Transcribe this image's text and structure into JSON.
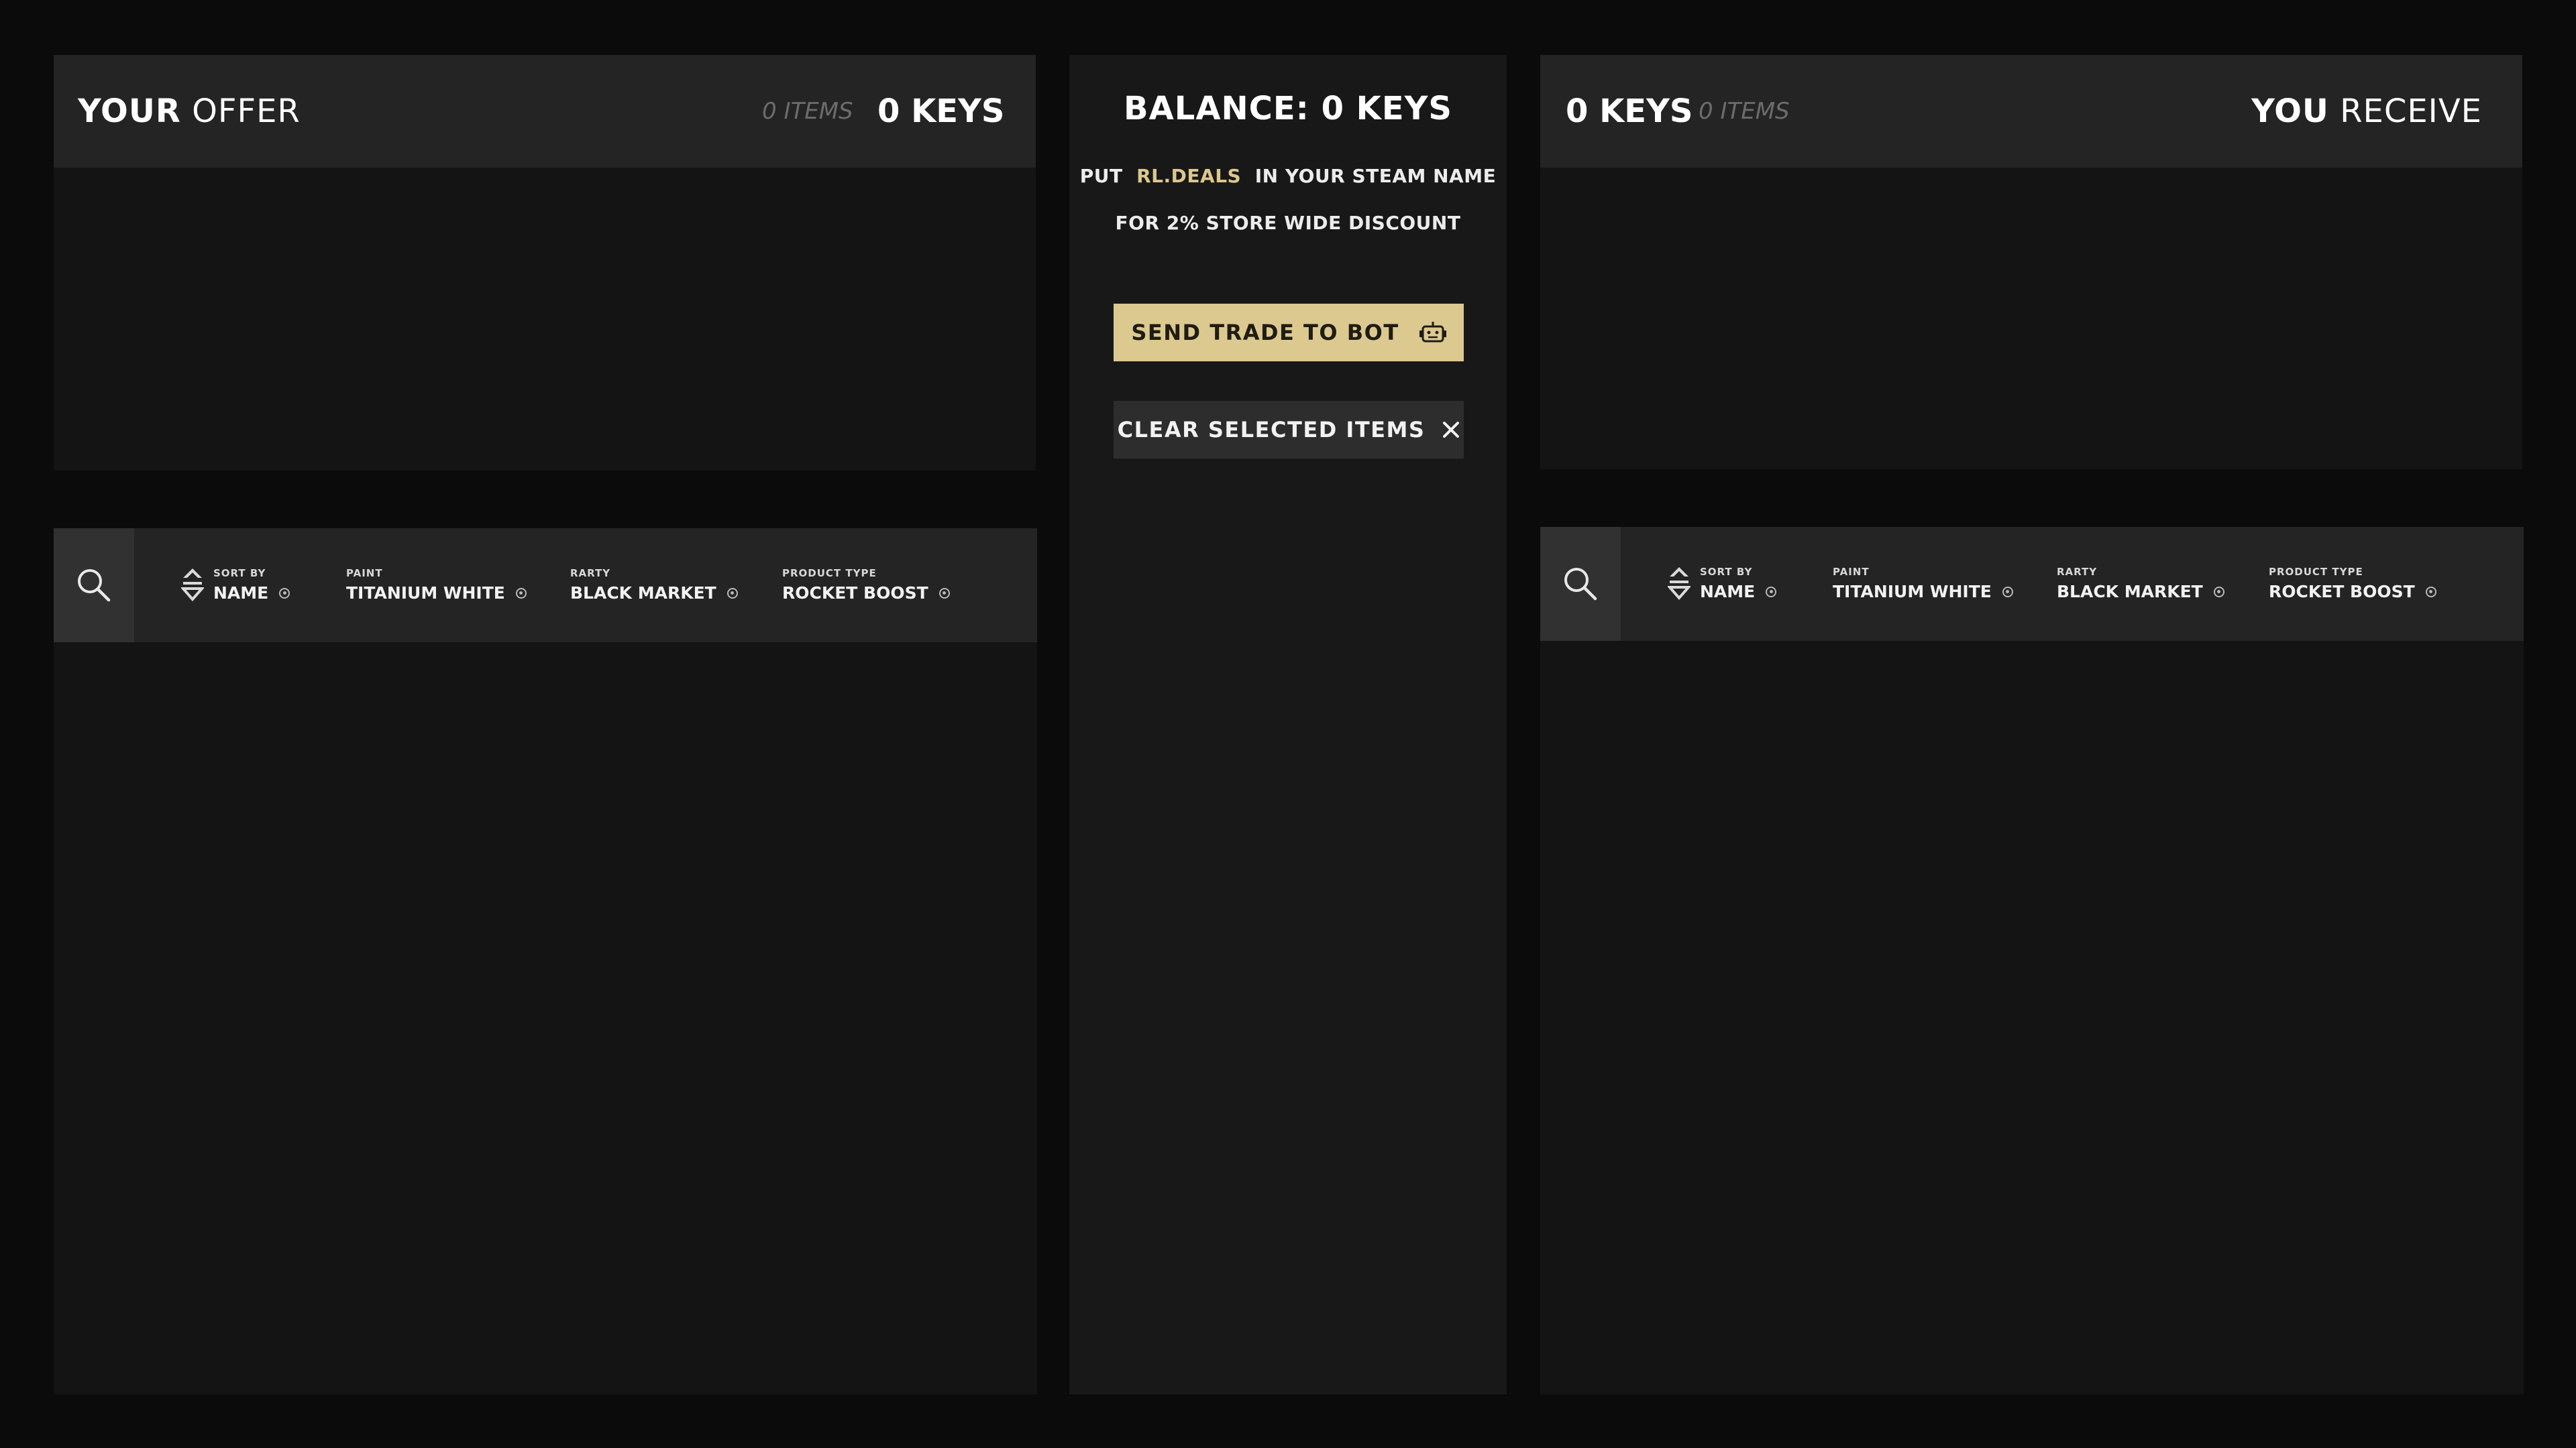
{
  "colors": {
    "background": "#0b0b0c",
    "panel": "#141414",
    "header": "#242424",
    "accent": "#dcc98f"
  },
  "left": {
    "title_bold": "YOUR",
    "title_light": "OFFER",
    "items_count": "0 ITEMS",
    "keys_count": "0 KEYS"
  },
  "right": {
    "title_bold": "YOU",
    "title_light": "RECEIVE",
    "items_count": "0 ITEMS",
    "keys_count": "0 KEYS"
  },
  "center": {
    "balance": "BALANCE: 0 KEYS",
    "promo_prefix": "PUT",
    "promo_highlight": "RL.DEALS",
    "promo_suffix": "IN YOUR STEAM NAME",
    "promo_line2": "FOR 2% STORE WIDE DISCOUNT",
    "send_label": "SEND TRADE TO BOT",
    "clear_label": "CLEAR SELECTED ITEMS",
    "send_icon": "robot-icon",
    "clear_icon": "close-icon"
  },
  "filters": {
    "sort_label": "SORT BY",
    "sort_value": "NAME",
    "paint_label": "PAINT",
    "paint_value": "TITANIUM WHITE",
    "rarity_label": "RARTY",
    "rarity_value": "BLACK MARKET",
    "type_label": "PRODUCT TYPE",
    "type_value": "ROCKET BOOST",
    "search_icon": "search-icon",
    "sort_icon": "sort-icon"
  }
}
